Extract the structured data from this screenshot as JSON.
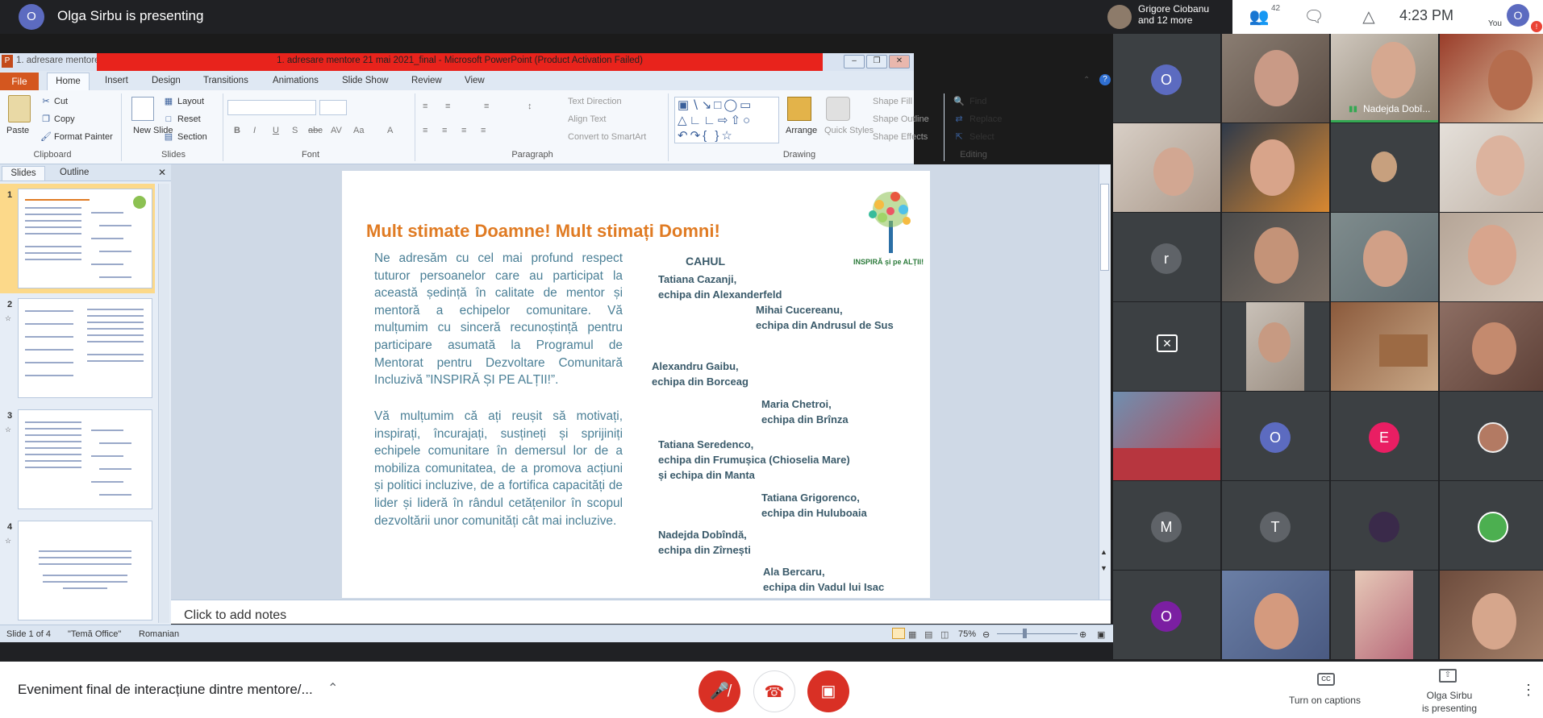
{
  "topbar": {
    "presenter_initial": "O",
    "presenter_text": "Olga Sirbu is presenting",
    "participant_name": "Grigore Ciobanu",
    "participant_more": "and 12 more",
    "people_count": "42",
    "time": "4:23 PM",
    "you_label": "You",
    "you_initial": "O"
  },
  "ppt": {
    "window_file_label": "1. adresare mentore",
    "window_title": "1. adresare mentore 21 mai 2021_final - Microsoft PowerPoint (Product Activation Failed)",
    "tabs": [
      "File",
      "Home",
      "Insert",
      "Design",
      "Transitions",
      "Animations",
      "Slide Show",
      "Review",
      "View"
    ],
    "ribbon": {
      "clipboard": {
        "paste": "Paste",
        "cut": "Cut",
        "copy": "Copy",
        "format_painter": "Format Painter",
        "label": "Clipboard"
      },
      "slides": {
        "new_slide": "New Slide",
        "layout": "Layout",
        "reset": "Reset",
        "section": "Section",
        "label": "Slides"
      },
      "font": {
        "label": "Font"
      },
      "paragraph": {
        "text_direction": "Text Direction",
        "align_text": "Align Text",
        "convert_smartart": "Convert to SmartArt",
        "label": "Paragraph"
      },
      "drawing": {
        "arrange": "Arrange",
        "quick_styles": "Quick Styles",
        "shape_fill": "Shape Fill",
        "shape_outline": "Shape Outline",
        "shape_effects": "Shape Effects",
        "label": "Drawing"
      },
      "editing": {
        "find": "Find",
        "replace": "Replace",
        "select": "Select",
        "label": "Editing"
      }
    },
    "pane_tabs": [
      "Slides",
      "Outline"
    ],
    "thumb_numbers": [
      "1",
      "2",
      "3",
      "4"
    ],
    "slide": {
      "title": "Mult stimate Doamne! Mult stimați Domni!",
      "paragraph1": "Ne adresăm cu cel mai profund respect tuturor persoanelor care au participat la această ședință în calitate de mentor și mentoră a echipelor comunitare. Vă mulțumim cu sinceră recunoștință pentru participare asumată la Programul de Mentorat pentru Dezvoltare Comunitară Incluzivă ”INSPIRĂ ȘI PE ALȚII!”.",
      "paragraph2": "Vă mulțumim că ați reușit să motivați, inspirați, încurajați, susțineți și sprijiniți echipele comunitare în demersul lor de a mobiliza comunitatea, de a promova acțiuni și politici incluzive, de a fortifica capacități de lider și lideră în rândul cetățenilor în scopul dezvoltării unor comunități cât mai incluzive.",
      "region": "CAHUL",
      "logo_text": "INSPIRĂ și pe ALȚII!",
      "mentors": [
        {
          "name": "Tatiana Cazanji,",
          "team": "echipa din Alexanderfeld"
        },
        {
          "name": "Mihai Cucereanu,",
          "team": "echipa din Andrusul de Sus"
        },
        {
          "name": "Alexandru Gaibu,",
          "team": "echipa din Borceag"
        },
        {
          "name": "Maria Chetroi,",
          "team": "echipa din Brînza"
        },
        {
          "name": "Tatiana Seredenco,",
          "team": "echipa din Frumușica (Chioselia Mare)",
          "team2": "și echipa din Manta"
        },
        {
          "name": "Tatiana Grigorenco,",
          "team": "echipa din Huluboaia"
        },
        {
          "name": "Nadejda Dobîndă,",
          "team": "echipa din Zîrnești"
        },
        {
          "name": "Ala Bercaru,",
          "team": "echipa din Vadul lui Isac"
        }
      ]
    },
    "notes_placeholder": "Click to add notes",
    "status": {
      "slide": "Slide 1 of 4",
      "theme": "\"Temă Office\"",
      "language": "Romanian",
      "zoom": "75%"
    }
  },
  "grid": {
    "speaking_name": "Nadejda Dobî...",
    "avatars": [
      {
        "initial": "O",
        "color": "#5c6bc0"
      },
      {
        "initial": "r",
        "color": "#5f6368"
      },
      {
        "initial": "O",
        "color": "#5c6bc0"
      },
      {
        "initial": "E",
        "color": "#e91e63"
      },
      {
        "initial": "M",
        "color": "#5f6368"
      },
      {
        "initial": "T",
        "color": "#5f6368"
      },
      {
        "initial": "O",
        "color": "#7b1fa2"
      }
    ]
  },
  "bottombar": {
    "meeting_name": "Eveniment final de interacțiune dintre mentore/...",
    "captions": "Turn on captions",
    "presenting_line1": "Olga Sirbu",
    "presenting_line2": "is presenting"
  }
}
